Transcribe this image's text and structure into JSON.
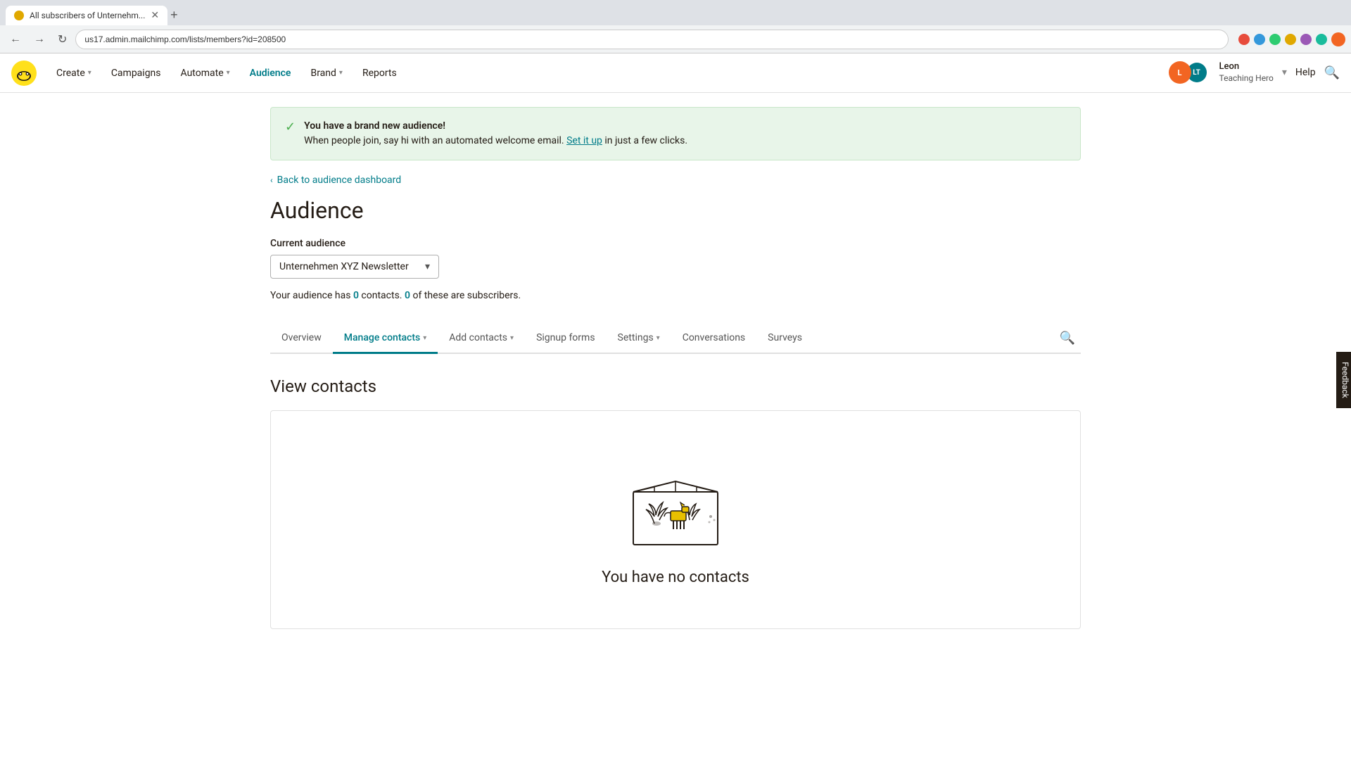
{
  "browser": {
    "tab_title": "All subscribers of Unternehm...",
    "new_tab_label": "+",
    "address": "us17.admin.mailchimp.com/lists/members?id=208500",
    "back_btn": "←",
    "forward_btn": "→",
    "refresh_btn": "↻"
  },
  "header": {
    "nav_items": [
      {
        "label": "Create",
        "has_chevron": true,
        "active": false
      },
      {
        "label": "Campaigns",
        "has_chevron": false,
        "active": false
      },
      {
        "label": "Automate",
        "has_chevron": true,
        "active": false
      },
      {
        "label": "Audience",
        "has_chevron": false,
        "active": true
      },
      {
        "label": "Brand",
        "has_chevron": true,
        "active": false
      },
      {
        "label": "Reports",
        "has_chevron": false,
        "active": false
      }
    ],
    "help_label": "Help",
    "user": {
      "initials": "LT",
      "name": "Leon",
      "subtitle": "Teaching Hero",
      "avatar_color": "#f26522",
      "avatar2_color": "#007c89"
    }
  },
  "banner": {
    "title": "You have a brand new audience!",
    "body": "When people join, say hi with an automated welcome email.",
    "link_text": "Set it up",
    "body_after": "in just a few clicks."
  },
  "back_link": {
    "label": "Back to audience dashboard"
  },
  "page": {
    "title": "Audience",
    "current_audience_label": "Current audience",
    "audience_name": "Unternehmen XYZ Newsletter",
    "stats_text": "Your audience has",
    "contacts_count": "0",
    "stats_mid": "contacts.",
    "subscribers_count": "0",
    "stats_end": "of these are subscribers."
  },
  "tabs": [
    {
      "label": "Overview",
      "active": false,
      "has_chevron": false
    },
    {
      "label": "Manage contacts",
      "active": true,
      "has_chevron": true
    },
    {
      "label": "Add contacts",
      "active": false,
      "has_chevron": true
    },
    {
      "label": "Signup forms",
      "active": false,
      "has_chevron": false
    },
    {
      "label": "Settings",
      "active": false,
      "has_chevron": true
    },
    {
      "label": "Conversations",
      "active": false,
      "has_chevron": false
    },
    {
      "label": "Surveys",
      "active": false,
      "has_chevron": false
    }
  ],
  "view_contacts": {
    "title": "View contacts",
    "empty_title": "You have no contacts"
  },
  "feedback": {
    "label": "Feedback"
  }
}
